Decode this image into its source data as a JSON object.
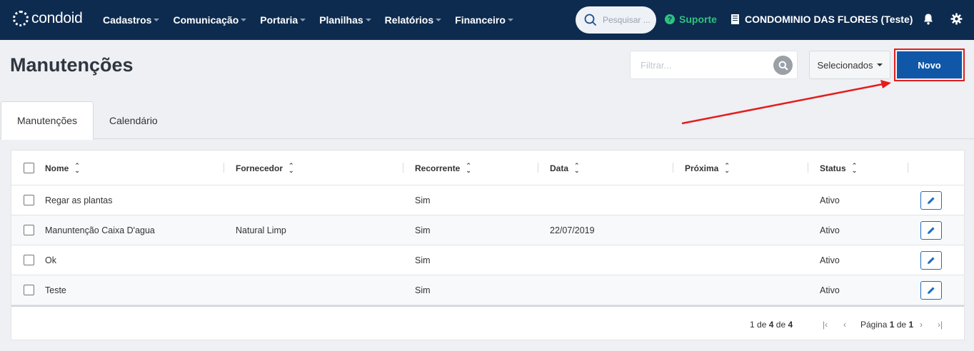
{
  "brand": {
    "name": "condoid"
  },
  "nav": {
    "items": [
      "Cadastros",
      "Comunicação",
      "Portaria",
      "Planilhas",
      "Relatórios",
      "Financeiro"
    ],
    "search_placeholder": "Pesquisar ...",
    "support": "Suporte",
    "condominium": "CONDOMINIO DAS FLORES (Teste)"
  },
  "page": {
    "title": "Manutenções",
    "filter_placeholder": "Filtrar...",
    "selected_label": "Selecionados",
    "new_label": "Novo"
  },
  "tabs": [
    "Manutenções",
    "Calendário"
  ],
  "table": {
    "columns": [
      "Nome",
      "Fornecedor",
      "Recorrente",
      "Data",
      "Próxima",
      "Status"
    ],
    "rows": [
      {
        "nome": "Regar as plantas",
        "fornecedor": "",
        "recorrente": "Sim",
        "data": "",
        "proxima": "",
        "status": "Ativo"
      },
      {
        "nome": "Manuntenção Caixa D'agua",
        "fornecedor": "Natural Limp",
        "recorrente": "Sim",
        "data": "22/07/2019",
        "proxima": "",
        "status": "Ativo"
      },
      {
        "nome": "Ok",
        "fornecedor": "",
        "recorrente": "Sim",
        "data": "",
        "proxima": "",
        "status": "Ativo"
      },
      {
        "nome": "Teste",
        "fornecedor": "",
        "recorrente": "Sim",
        "data": "",
        "proxima": "",
        "status": "Ativo"
      }
    ]
  },
  "pagination": {
    "range_start": "1",
    "range_of": "de",
    "range_end": "4",
    "total_of": "de",
    "total": "4",
    "page_label": "Página",
    "current_page": "1",
    "page_of": "de",
    "page_count": "1"
  },
  "colors": {
    "navbar": "#0d2b4f",
    "primary": "#1157a8",
    "support": "#2ec27e",
    "highlight": "#e02020"
  },
  "icons": [
    "search-icon",
    "help-icon",
    "building-icon",
    "bell-icon",
    "gear-icon",
    "pencil-icon",
    "first-page-icon",
    "prev-page-icon",
    "next-page-icon",
    "last-page-icon"
  ]
}
